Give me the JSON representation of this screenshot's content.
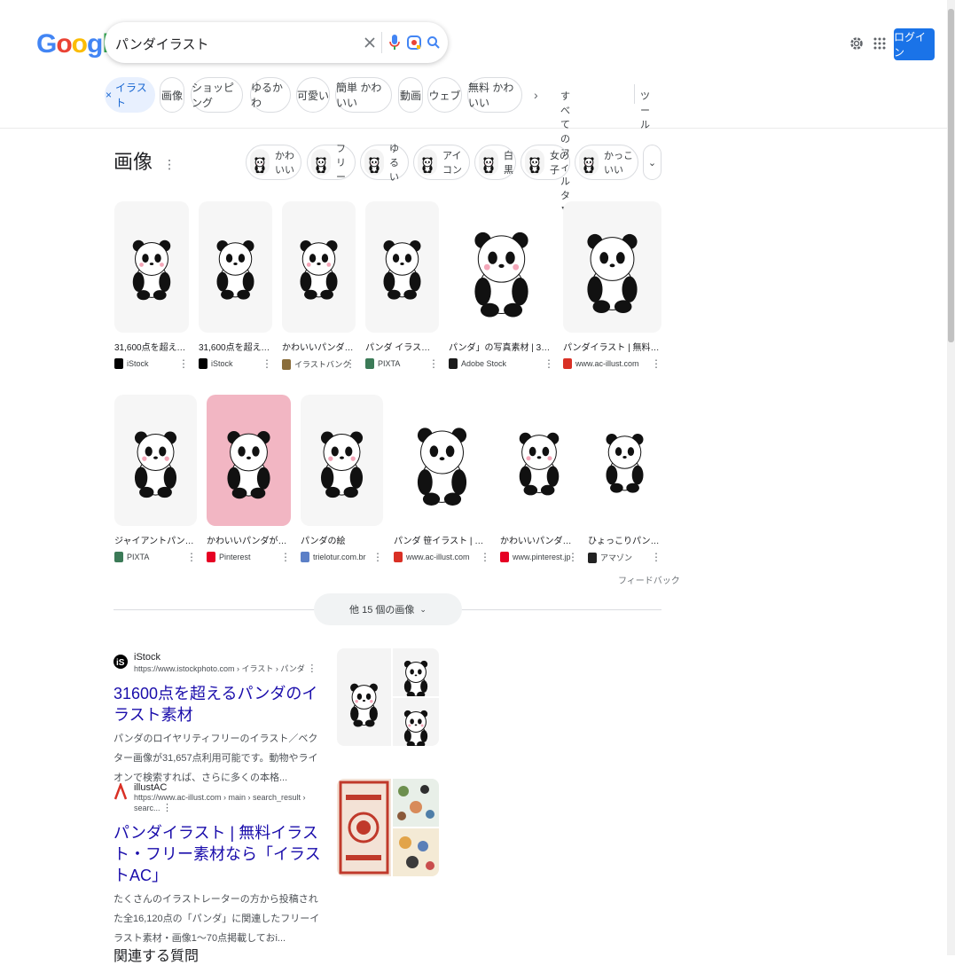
{
  "header": {
    "logo": {
      "letters": [
        "G",
        "o",
        "o",
        "g",
        "l",
        "e"
      ],
      "colors": [
        "#4285F4",
        "#EA4335",
        "#FBBC05",
        "#4285F4",
        "#34A853",
        "#EA4335"
      ]
    },
    "search": {
      "query": "パンダイラスト",
      "clear_icon": "close-icon",
      "mic_icon": "mic-icon",
      "lens_icon": "lens-icon",
      "search_icon": "search-icon"
    },
    "settings_icon": "gear-icon",
    "apps_icon": "apps-grid-icon",
    "login_label": "ログイン"
  },
  "chips": {
    "items": [
      "イラスト",
      "画像",
      "ショッピング",
      "ゆるかわ",
      "可愛い",
      "簡単 かわいい",
      "動画",
      "ウェブ",
      "無料 かわいい"
    ],
    "active_prefix": "×",
    "all_filters": "すべてのフィルタ",
    "tools": "ツール"
  },
  "images": {
    "heading": "画像",
    "topic_chips": [
      "かわいい",
      "フリー",
      "ゆるい",
      "アイコン",
      "白黒",
      "女の子",
      "かっこいい"
    ],
    "row1": [
      {
        "caption": "31,600点を超えるパ...",
        "source": "iStock"
      },
      {
        "caption": "31,600点を超える...",
        "source": "iStock"
      },
      {
        "caption": "かわいいパンダのフ...",
        "source": "イラストバンク"
      },
      {
        "caption": "パンダ イラスト 手...",
        "source": "PIXTA"
      },
      {
        "caption": "パンダ」の写真素材 | 306,89...",
        "source": "Adobe Stock"
      },
      {
        "caption": "パンダイラスト | 無料イラ...",
        "source": "www.ac-illust.com"
      }
    ],
    "row2": [
      {
        "caption": "ジャイアントパンダの...",
        "source": "PIXTA"
      },
      {
        "caption": "かわいいパンダがドー...",
        "source": "Pinterest"
      },
      {
        "caption": "パンダの絵",
        "source": "trielotur.com.br"
      },
      {
        "caption": "パンダ 笹イラスト | 無料イ...",
        "source": "www.ac-illust.com"
      },
      {
        "caption": "かわいいパンダのイ...",
        "source": "www.pinterest.jp"
      },
      {
        "caption": "ひょっこりパンダ ...",
        "source": "アマゾン"
      }
    ],
    "feedback": "フィードバック",
    "more": "他 15 個の画像"
  },
  "results": [
    {
      "site": "iStock",
      "url": "https://www.istockphoto.com › イラスト › パンダ",
      "title": "31600点を超えるパンダのイラスト素材",
      "snippet": "パンダのロイヤリティフリーのイラスト／ベクター画像が31,657点利用可能です。動物やライオンで検索すれば、さらに多くの本格..."
    },
    {
      "site": "illustAC",
      "url": "https://www.ac-illust.com › main › search_result › searc...",
      "title": "パンダイラスト | 無料イラスト・フリー素材なら「イラストAC」",
      "snippet": "たくさんのイラストレーターの方から投稿された全16,120点の「パンダ」に関連したフリーイラスト素材・画像1〜70点掲載しておi..."
    }
  ],
  "related_heading": "関連する質問"
}
